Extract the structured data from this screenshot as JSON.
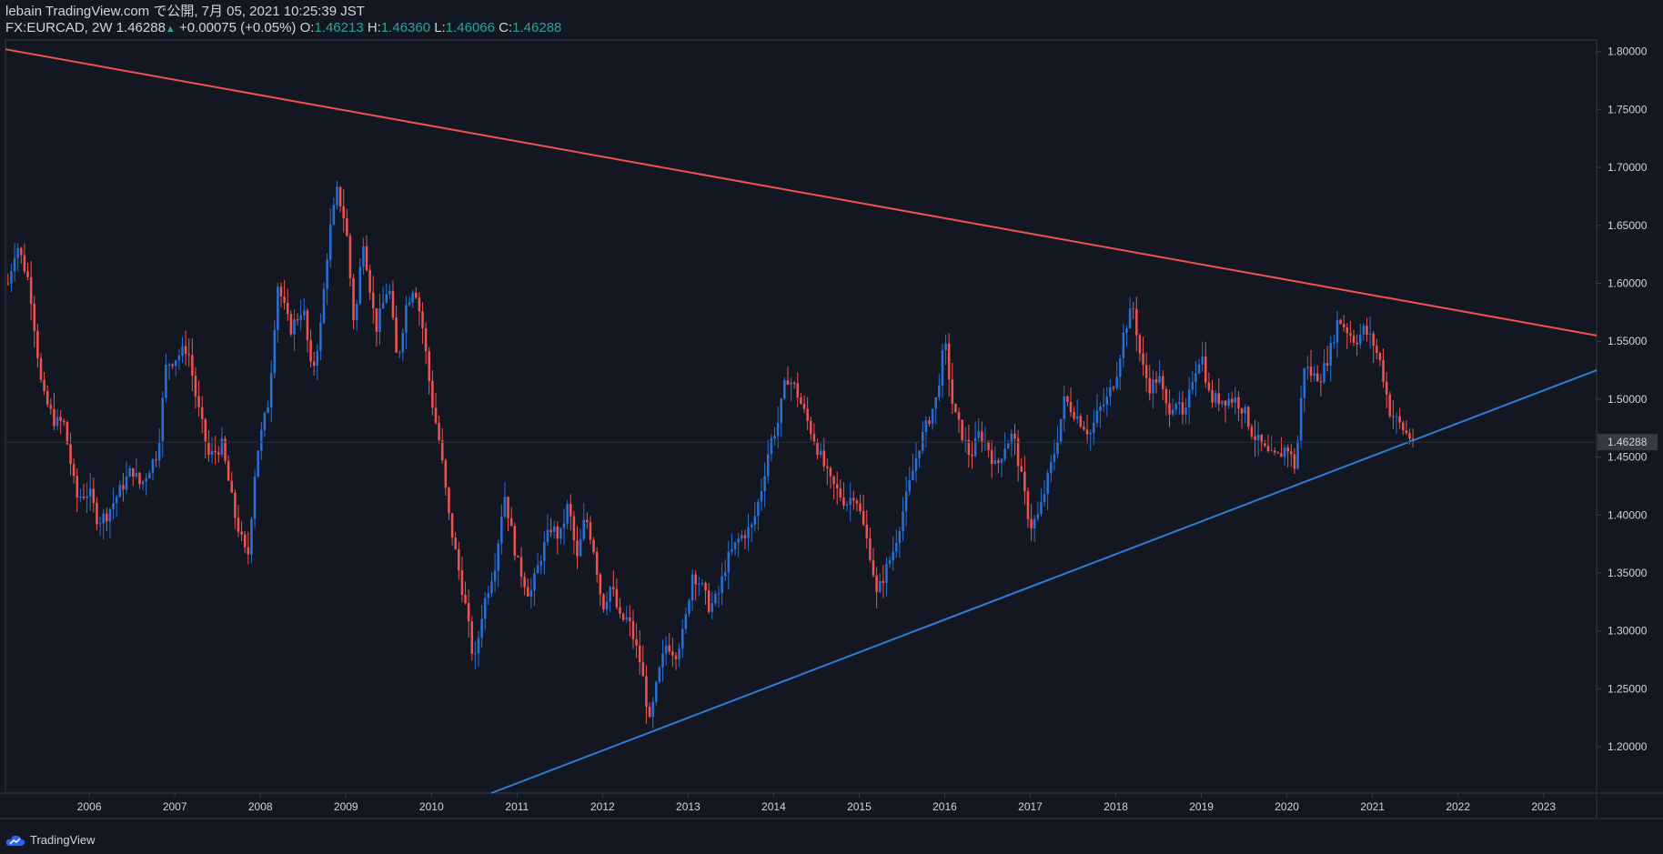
{
  "header": {
    "publisher_line": "lebain TradingView.com で公開, 7月 05, 2021 10:25:39 JST",
    "symbol": "FX:EURCAD, 2W",
    "last": "1.46288",
    "change": "+0.00075 (+0.05%)",
    "o_label": "O:",
    "o_value": "1.46213",
    "h_label": "H:",
    "h_value": "1.46360",
    "l_label": "L:",
    "l_value": "1.46066",
    "c_label": "C:",
    "c_value": "1.46288"
  },
  "footer": {
    "brand": "TradingView"
  },
  "colors": {
    "background": "#131722",
    "up": "#2a6fd6",
    "down": "#ef5350",
    "resistance": "#ef5350",
    "support": "#2f7bd8",
    "axis_text": "#d1d4dc"
  },
  "chart_data": {
    "type": "candlestick",
    "symbol": "FX:EURCAD",
    "interval": "2W",
    "ylim": [
      1.16,
      1.81
    ],
    "xlim": [
      2005.02,
      2023.62
    ],
    "y_ticks": [
      "1.80000",
      "1.75000",
      "1.70000",
      "1.65000",
      "1.60000",
      "1.55000",
      "1.50000",
      "1.45000",
      "1.40000",
      "1.35000",
      "1.30000",
      "1.25000",
      "1.20000"
    ],
    "x_ticks": [
      "2006",
      "2007",
      "2008",
      "2009",
      "2010",
      "2011",
      "2012",
      "2013",
      "2014",
      "2015",
      "2016",
      "2017",
      "2018",
      "2019",
      "2020",
      "2021",
      "2022",
      "2023"
    ],
    "last_price": "1.46288",
    "trendlines": [
      {
        "name": "resistance",
        "color": "#ef5350",
        "points": [
          [
            2005.02,
            1.802
          ],
          [
            2023.62,
            1.555
          ]
        ]
      },
      {
        "name": "support",
        "color": "#2f7bd8",
        "points": [
          [
            2010.7,
            1.16
          ],
          [
            2023.62,
            1.525
          ]
        ]
      }
    ],
    "close_path": [
      [
        2005.05,
        1.6
      ],
      [
        2005.15,
        1.635
      ],
      [
        2005.3,
        1.6
      ],
      [
        2005.45,
        1.505
      ],
      [
        2005.6,
        1.48
      ],
      [
        2005.7,
        1.48
      ],
      [
        2005.85,
        1.415
      ],
      [
        2006.0,
        1.42
      ],
      [
        2006.1,
        1.395
      ],
      [
        2006.2,
        1.4
      ],
      [
        2006.35,
        1.42
      ],
      [
        2006.5,
        1.44
      ],
      [
        2006.6,
        1.425
      ],
      [
        2006.8,
        1.455
      ],
      [
        2006.9,
        1.53
      ],
      [
        2007.0,
        1.535
      ],
      [
        2007.15,
        1.545
      ],
      [
        2007.25,
        1.5
      ],
      [
        2007.4,
        1.45
      ],
      [
        2007.55,
        1.46
      ],
      [
        2007.7,
        1.4
      ],
      [
        2007.85,
        1.36
      ],
      [
        2007.95,
        1.45
      ],
      [
        2008.1,
        1.5
      ],
      [
        2008.2,
        1.6
      ],
      [
        2008.35,
        1.56
      ],
      [
        2008.5,
        1.58
      ],
      [
        2008.6,
        1.52
      ],
      [
        2008.7,
        1.56
      ],
      [
        2008.8,
        1.64
      ],
      [
        2008.9,
        1.68
      ],
      [
        2009.0,
        1.65
      ],
      [
        2009.1,
        1.56
      ],
      [
        2009.2,
        1.64
      ],
      [
        2009.35,
        1.56
      ],
      [
        2009.5,
        1.6
      ],
      [
        2009.6,
        1.53
      ],
      [
        2009.7,
        1.58
      ],
      [
        2009.8,
        1.6
      ],
      [
        2009.9,
        1.56
      ],
      [
        2010.0,
        1.5
      ],
      [
        2010.1,
        1.46
      ],
      [
        2010.2,
        1.4
      ],
      [
        2010.3,
        1.36
      ],
      [
        2010.4,
        1.32
      ],
      [
        2010.5,
        1.27
      ],
      [
        2010.6,
        1.32
      ],
      [
        2010.75,
        1.36
      ],
      [
        2010.85,
        1.42
      ],
      [
        2011.0,
        1.36
      ],
      [
        2011.15,
        1.33
      ],
      [
        2011.3,
        1.37
      ],
      [
        2011.4,
        1.39
      ],
      [
        2011.5,
        1.38
      ],
      [
        2011.6,
        1.41
      ],
      [
        2011.7,
        1.36
      ],
      [
        2011.8,
        1.4
      ],
      [
        2011.9,
        1.37
      ],
      [
        2012.0,
        1.32
      ],
      [
        2012.1,
        1.34
      ],
      [
        2012.2,
        1.31
      ],
      [
        2012.3,
        1.31
      ],
      [
        2012.45,
        1.27
      ],
      [
        2012.55,
        1.22
      ],
      [
        2012.65,
        1.26
      ],
      [
        2012.75,
        1.29
      ],
      [
        2012.85,
        1.28
      ],
      [
        2012.95,
        1.3
      ],
      [
        2013.05,
        1.35
      ],
      [
        2013.15,
        1.34
      ],
      [
        2013.25,
        1.32
      ],
      [
        2013.35,
        1.33
      ],
      [
        2013.45,
        1.36
      ],
      [
        2013.6,
        1.38
      ],
      [
        2013.75,
        1.39
      ],
      [
        2013.85,
        1.42
      ],
      [
        2013.95,
        1.46
      ],
      [
        2014.05,
        1.48
      ],
      [
        2014.15,
        1.52
      ],
      [
        2014.25,
        1.51
      ],
      [
        2014.35,
        1.49
      ],
      [
        2014.45,
        1.47
      ],
      [
        2014.55,
        1.45
      ],
      [
        2014.65,
        1.43
      ],
      [
        2014.75,
        1.42
      ],
      [
        2014.85,
        1.41
      ],
      [
        2014.95,
        1.42
      ],
      [
        2015.05,
        1.39
      ],
      [
        2015.15,
        1.36
      ],
      [
        2015.2,
        1.33
      ],
      [
        2015.3,
        1.35
      ],
      [
        2015.4,
        1.37
      ],
      [
        2015.5,
        1.4
      ],
      [
        2015.6,
        1.43
      ],
      [
        2015.7,
        1.46
      ],
      [
        2015.8,
        1.48
      ],
      [
        2015.9,
        1.5
      ],
      [
        2016.0,
        1.55
      ],
      [
        2016.05,
        1.52
      ],
      [
        2016.1,
        1.49
      ],
      [
        2016.2,
        1.47
      ],
      [
        2016.3,
        1.45
      ],
      [
        2016.4,
        1.47
      ],
      [
        2016.5,
        1.46
      ],
      [
        2016.6,
        1.44
      ],
      [
        2016.7,
        1.46
      ],
      [
        2016.8,
        1.47
      ],
      [
        2016.9,
        1.43
      ],
      [
        2017.0,
        1.39
      ],
      [
        2017.1,
        1.4
      ],
      [
        2017.2,
        1.43
      ],
      [
        2017.3,
        1.46
      ],
      [
        2017.4,
        1.5
      ],
      [
        2017.5,
        1.49
      ],
      [
        2017.6,
        1.48
      ],
      [
        2017.7,
        1.47
      ],
      [
        2017.8,
        1.49
      ],
      [
        2017.9,
        1.5
      ],
      [
        2018.0,
        1.52
      ],
      [
        2018.1,
        1.56
      ],
      [
        2018.2,
        1.58
      ],
      [
        2018.3,
        1.53
      ],
      [
        2018.4,
        1.51
      ],
      [
        2018.5,
        1.52
      ],
      [
        2018.6,
        1.49
      ],
      [
        2018.7,
        1.5
      ],
      [
        2018.8,
        1.48
      ],
      [
        2018.9,
        1.52
      ],
      [
        2019.0,
        1.54
      ],
      [
        2019.1,
        1.5
      ],
      [
        2019.2,
        1.5
      ],
      [
        2019.3,
        1.5
      ],
      [
        2019.4,
        1.5
      ],
      [
        2019.5,
        1.49
      ],
      [
        2019.6,
        1.47
      ],
      [
        2019.7,
        1.46
      ],
      [
        2019.8,
        1.45
      ],
      [
        2019.9,
        1.45
      ],
      [
        2020.0,
        1.46
      ],
      [
        2020.1,
        1.44
      ],
      [
        2020.2,
        1.53
      ],
      [
        2020.3,
        1.52
      ],
      [
        2020.4,
        1.52
      ],
      [
        2020.5,
        1.54
      ],
      [
        2020.6,
        1.57
      ],
      [
        2020.7,
        1.56
      ],
      [
        2020.8,
        1.55
      ],
      [
        2020.9,
        1.56
      ],
      [
        2021.0,
        1.55
      ],
      [
        2021.1,
        1.53
      ],
      [
        2021.2,
        1.49
      ],
      [
        2021.3,
        1.48
      ],
      [
        2021.4,
        1.47
      ],
      [
        2021.5,
        1.46288
      ]
    ]
  }
}
